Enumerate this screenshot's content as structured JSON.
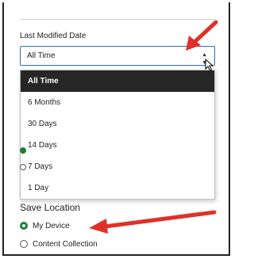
{
  "filters": {
    "last_modified": {
      "label": "Last Modified Date",
      "selected": "All Time",
      "options": [
        "All Time",
        "6 Months",
        "30 Days",
        "14 Days",
        "7 Days",
        "1 Day"
      ]
    }
  },
  "save_location": {
    "title": "Save Location",
    "options": [
      {
        "label": "My Device",
        "checked": true
      },
      {
        "label": "Content Collection",
        "checked": false
      }
    ]
  },
  "colors": {
    "annotation_arrow": "#e0302a",
    "selected_option_bg": "#262626",
    "radio_checked": "#1a7f3a",
    "select_border": "#2f6fb5"
  },
  "icons": {
    "select_caret": "caret-icon",
    "cursor": "mouse-cursor-icon",
    "annotation": "red-arrow-icon"
  }
}
